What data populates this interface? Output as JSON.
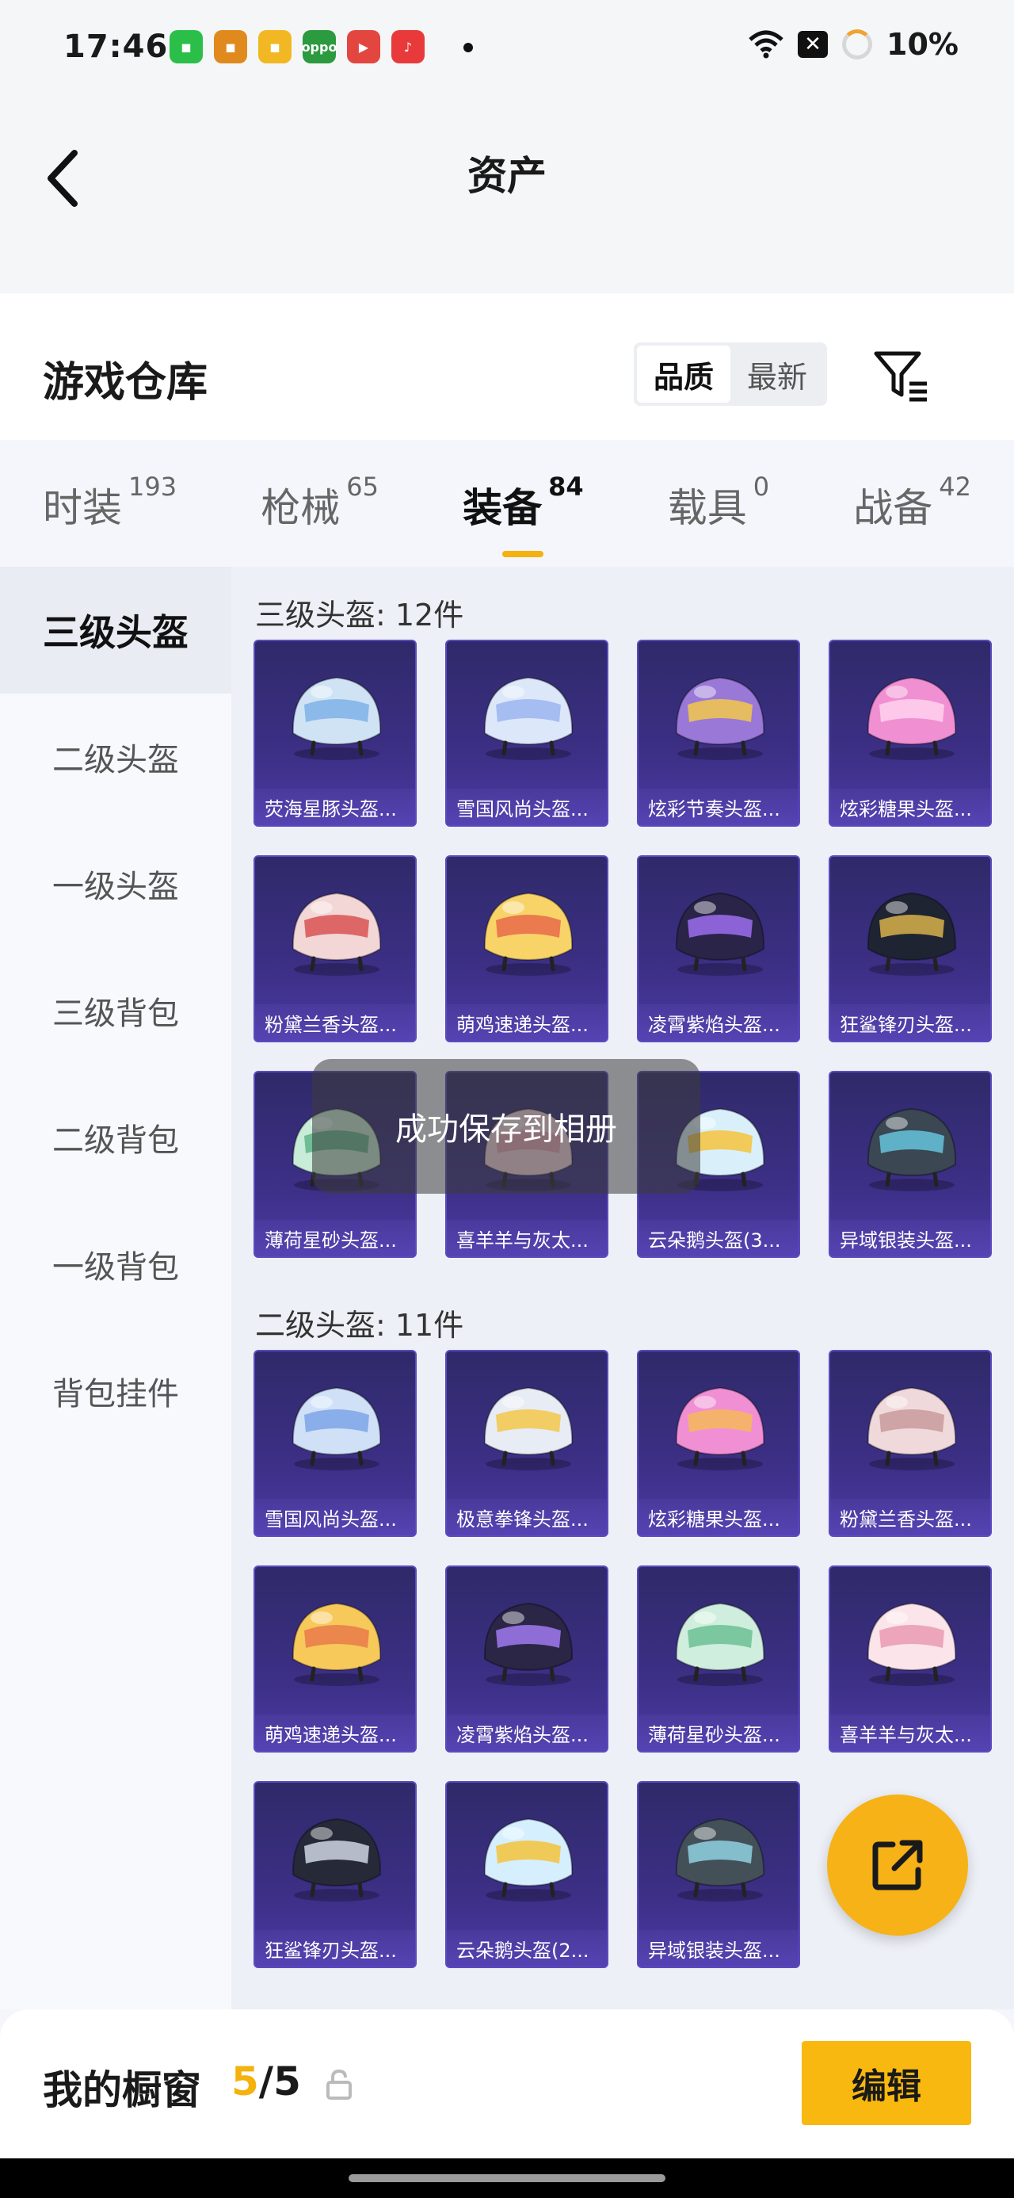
{
  "status_bar": {
    "time": "17:46",
    "battery": "10%",
    "apps": [
      {
        "name": "green-app-icon",
        "color": "#2bbf4a",
        "glyph": "◼"
      },
      {
        "name": "orange-app-icon",
        "color": "#e08a1e",
        "glyph": "◼"
      },
      {
        "name": "yellow-app-icon",
        "color": "#f2b824",
        "glyph": "◼"
      },
      {
        "name": "oppo-app-icon",
        "color": "#2c9a3f",
        "glyph": "oppo"
      },
      {
        "name": "red-video-app-icon",
        "color": "#e2463f",
        "glyph": "▶"
      },
      {
        "name": "music-app-icon",
        "color": "#e83a3a",
        "glyph": "♪"
      }
    ]
  },
  "header": {
    "title": "资产"
  },
  "warehouse": {
    "title": "游戏仓库",
    "sort_options": [
      "品质",
      "最新"
    ],
    "active_sort": 0
  },
  "category_tabs": [
    {
      "label": "时装",
      "count": "193",
      "active": false
    },
    {
      "label": "枪械",
      "count": "65",
      "active": false
    },
    {
      "label": "装备",
      "count": "84",
      "active": true
    },
    {
      "label": "载具",
      "count": "0",
      "active": false
    },
    {
      "label": "战备",
      "count": "42",
      "active": false
    }
  ],
  "sidebar": [
    {
      "label": "三级头盔",
      "active": true
    },
    {
      "label": "二级头盔",
      "active": false
    },
    {
      "label": "一级头盔",
      "active": false
    },
    {
      "label": "三级背包",
      "active": false
    },
    {
      "label": "二级背包",
      "active": false
    },
    {
      "label": "一级背包",
      "active": false
    },
    {
      "label": "背包挂件",
      "active": false
    }
  ],
  "sections": [
    {
      "title": "三级头盔: 12件",
      "items": [
        {
          "label": "荧海星豚头盔...",
          "color": "#cfe3f5",
          "accent": "#7fb1e6"
        },
        {
          "label": "雪国风尚头盔...",
          "color": "#dde7fa",
          "accent": "#9bb5ef"
        },
        {
          "label": "炫彩节奏头盔...",
          "color": "#9a78d8",
          "accent": "#f2c84a"
        },
        {
          "label": "炫彩糖果头盔...",
          "color": "#f08fd2",
          "accent": "#ffd2ef"
        },
        {
          "label": "粉黛兰香头盔...",
          "color": "#f3d6d6",
          "accent": "#d85454"
        },
        {
          "label": "萌鸡速递头盔...",
          "color": "#f8d468",
          "accent": "#e96a4a"
        },
        {
          "label": "凌霄紫焰头盔...",
          "color": "#2a2448",
          "accent": "#9c6ff0"
        },
        {
          "label": "狂鲨锋刃头盔...",
          "color": "#1f2433",
          "accent": "#d8b24a"
        },
        {
          "label": "薄荷星砂头盔...",
          "color": "#c7ecd7",
          "accent": "#5fb58a"
        },
        {
          "label": "喜羊羊与灰太...",
          "color": "#f5d5df",
          "accent": "#e7a0b5"
        },
        {
          "label": "云朵鹅头盔(3...",
          "color": "#d9f0fb",
          "accent": "#f4c33c"
        },
        {
          "label": "异域银装头盔...",
          "color": "#3b4752",
          "accent": "#66c4dc"
        }
      ]
    },
    {
      "title": "二级头盔: 11件",
      "items": [
        {
          "label": "雪国风尚头盔...",
          "color": "#cfe0f7",
          "accent": "#7ea5e6"
        },
        {
          "label": "极意拳锋头盔...",
          "color": "#e7ecf5",
          "accent": "#f2c84a"
        },
        {
          "label": "炫彩糖果头盔...",
          "color": "#f18fd4",
          "accent": "#f6b95a"
        },
        {
          "label": "粉黛兰香头盔...",
          "color": "#f0d9da",
          "accent": "#c99a9c"
        },
        {
          "label": "萌鸡速递头盔...",
          "color": "#f7c95a",
          "accent": "#e97a4a"
        },
        {
          "label": "凌霄紫焰头盔...",
          "color": "#2b2546",
          "accent": "#a07af0"
        },
        {
          "label": "薄荷星砂头盔...",
          "color": "#cfeedd",
          "accent": "#6cbf95"
        },
        {
          "label": "喜羊羊与灰太...",
          "color": "#fbe4ea",
          "accent": "#e99ab2"
        },
        {
          "label": "狂鲨锋刃头盔...",
          "color": "#262a38",
          "accent": "#cfd5e2"
        },
        {
          "label": "云朵鹅头盔(2...",
          "color": "#d6efff",
          "accent": "#f4c33c"
        },
        {
          "label": "异域银装头盔...",
          "color": "#445058",
          "accent": "#8fd0e0"
        }
      ]
    }
  ],
  "toast": {
    "text": "成功保存到相册"
  },
  "bottom_bar": {
    "label": "我的橱窗",
    "current": "5",
    "separator": "/",
    "total": "5",
    "edit_label": "编辑"
  }
}
